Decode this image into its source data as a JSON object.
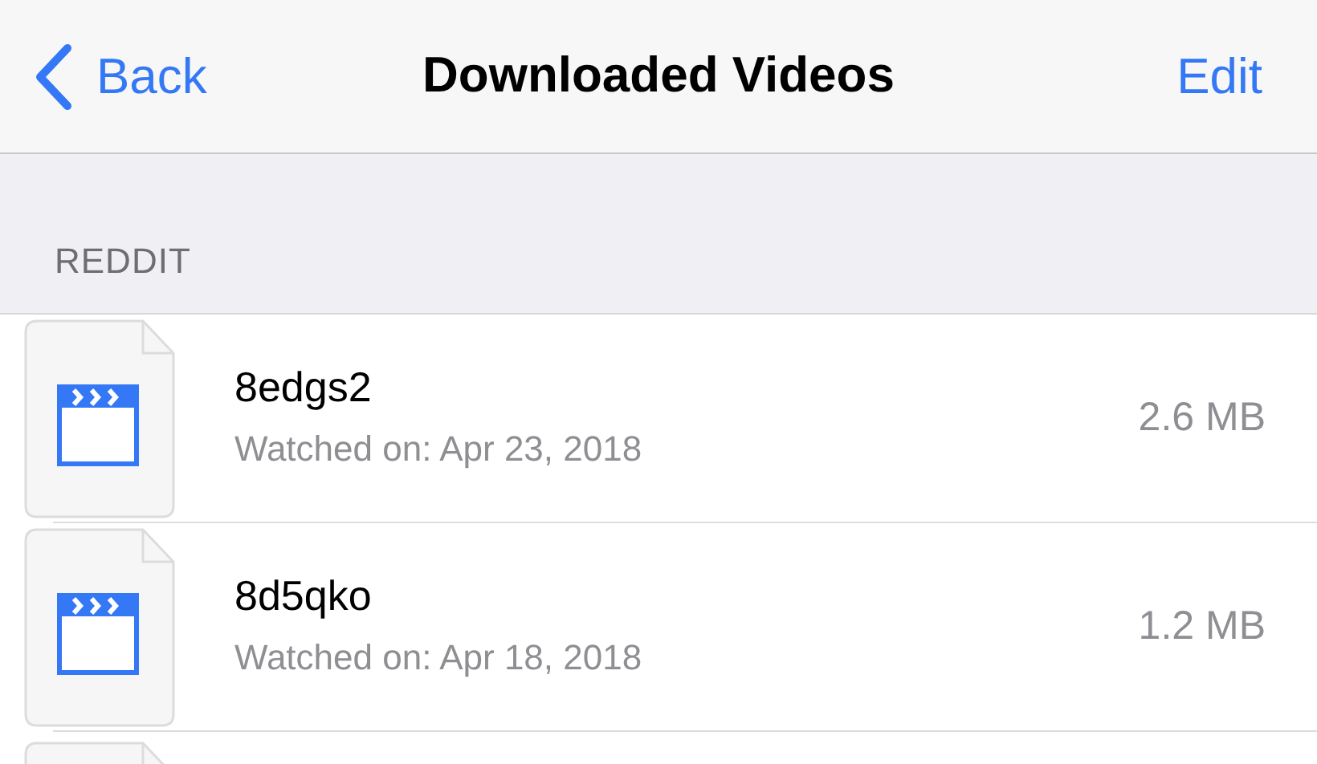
{
  "nav_bar": {
    "back_label": "Back",
    "title": "Downloaded Videos",
    "edit_label": "Edit"
  },
  "section": {
    "header": "REDDIT",
    "items": [
      {
        "name": "8edgs2",
        "subtitle": "Watched on: Apr 23, 2018",
        "size": "2.6 MB"
      },
      {
        "name": "8d5qko",
        "subtitle": "Watched on: Apr 18, 2018",
        "size": "1.2 MB"
      }
    ]
  }
}
